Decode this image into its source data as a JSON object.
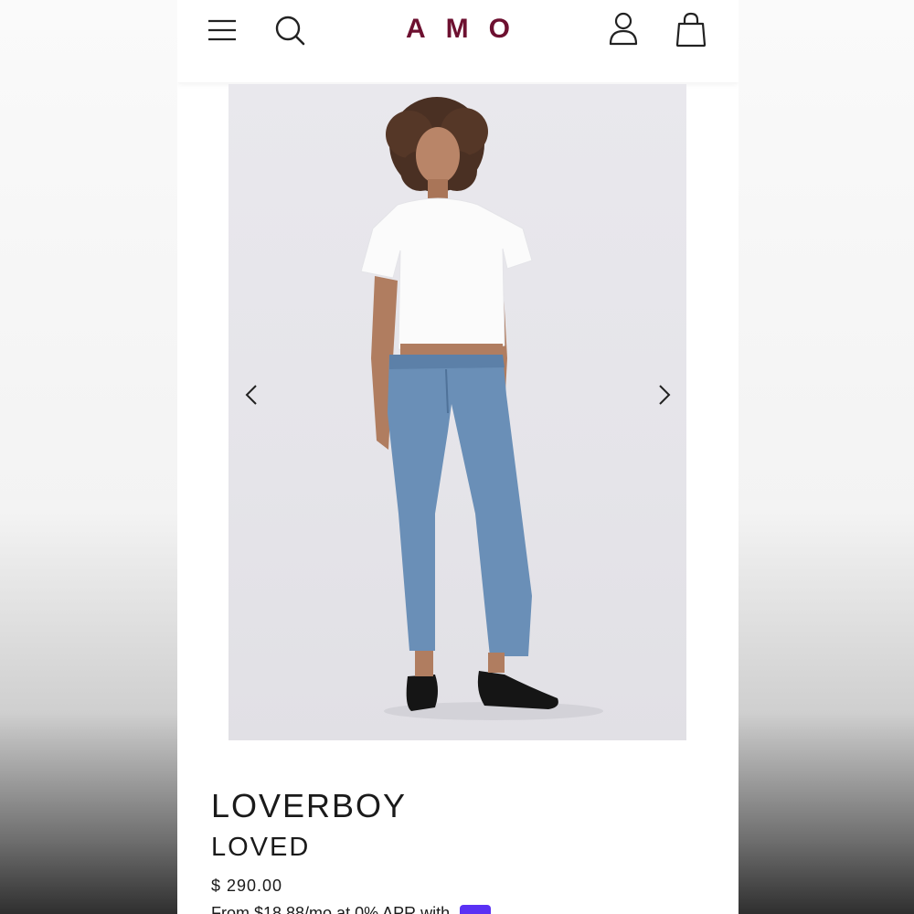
{
  "header": {
    "logo": "AMO",
    "logo_color": "#6d1030",
    "icons": [
      "menu-icon",
      "search-icon",
      "account-icon",
      "shopping-bag-icon"
    ]
  },
  "gallery": {
    "prev_icon": "chevron-left-icon",
    "next_icon": "chevron-right-icon",
    "image": "model-wearing-jeans"
  },
  "product": {
    "name": "LOVERBOY",
    "wash": "LOVED",
    "price": "$ 290.00",
    "installments": "From $18.88/mo at 0% APR with"
  }
}
